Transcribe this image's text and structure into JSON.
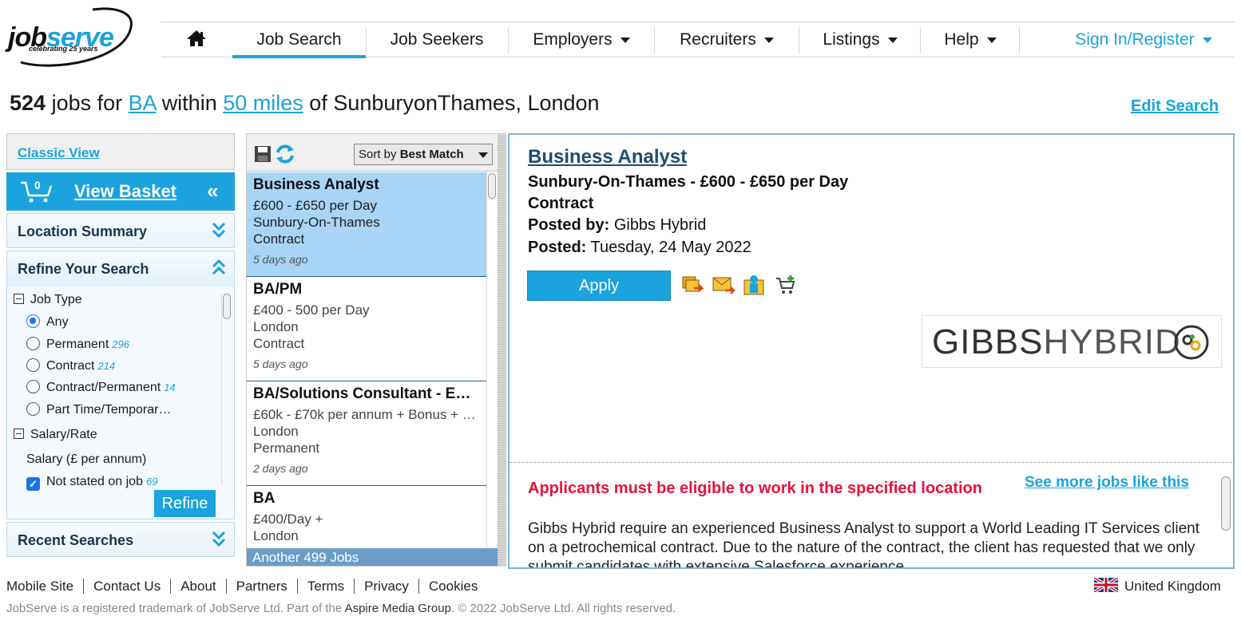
{
  "header": {
    "logo_main": "job",
    "logo_accent": "serve",
    "logo_tagline": "celebrating 25 years",
    "nav": [
      {
        "label": "Job Search"
      },
      {
        "label": "Job Seekers"
      },
      {
        "label": "Employers"
      },
      {
        "label": "Recruiters"
      },
      {
        "label": "Listings"
      },
      {
        "label": "Help"
      }
    ],
    "sign_in": "Sign In/Register"
  },
  "summary": {
    "count": "524",
    "jobs_for": "jobs for",
    "keyword": "BA",
    "within": "within",
    "radius": "50 miles",
    "of_location": "of SunburyonThames, London",
    "edit_search": "Edit Search"
  },
  "sidebar": {
    "classic_view": "Classic View",
    "basket_count": "0",
    "view_basket": "View Basket",
    "location_summary": "Location Summary",
    "refine_your_search": "Refine Your Search",
    "job_type_label": "Job Type",
    "job_types": [
      {
        "label": "Any",
        "count": ""
      },
      {
        "label": "Permanent",
        "count": "296"
      },
      {
        "label": "Contract",
        "count": "214"
      },
      {
        "label": "Contract/Permanent",
        "count": "14"
      },
      {
        "label": "Part Time/Temporar…",
        "count": ""
      }
    ],
    "salary_label": "Salary/Rate",
    "salary_sub": "Salary (£ per annum)",
    "not_stated": "Not stated on job",
    "not_stated_count": "69",
    "refine_button": "Refine",
    "recent_searches": "Recent Searches"
  },
  "results": {
    "sort_prefix": "Sort by",
    "sort_value": "Best Match",
    "jobs": [
      {
        "title": "Business Analyst",
        "rate": "£600 - £650 per Day",
        "location": "Sunbury-On-Thames",
        "type": "Contract",
        "ago": "5 days ago"
      },
      {
        "title": "BA/PM",
        "rate": "£400 - 500 per Day",
        "location": "London",
        "type": "Contract",
        "ago": "5 days ago"
      },
      {
        "title": "BA/Solutions Consultant - E…",
        "rate": "£60k - £70k per annum + Bonus + …",
        "location": "London",
        "type": "Permanent",
        "ago": "2 days ago"
      },
      {
        "title": "BA",
        "rate": "£400/Day +",
        "location": "London",
        "type": "",
        "ago": ""
      }
    ],
    "another": "Another 499 Jobs"
  },
  "detail": {
    "title": "Business Analyst",
    "location_rate": "Sunbury-On-Thames - £600 - £650 per Day",
    "type": "Contract",
    "posted_by_label": "Posted by:",
    "posted_by": "Gibbs Hybrid",
    "posted_label": "Posted:",
    "posted": "Tuesday, 24 May 2022",
    "apply": "Apply",
    "logo_text_bold": "GIBBS",
    "logo_text_light": "HYBRID",
    "eligible": "Applicants must be eligible to work in the specified location",
    "see_more": "See more jobs like this",
    "description": "Gibbs Hybrid require an experienced Business Analyst to support a World Leading IT Services client on a petrochemical contract. Due to the nature of the contract, the client has requested that we only submit candidates with extensive Salesforce experience."
  },
  "footer": {
    "links": [
      "Mobile Site",
      "Contact Us",
      "About",
      "Partners",
      "Terms",
      "Privacy",
      "Cookies"
    ],
    "country": "United Kingdom",
    "copy_pre": "JobServe is a registered trademark of JobServe Ltd. Part of the",
    "copy_amg": "Aspire Media Group",
    "copy_post": ". © 2022 JobServe Ltd. All rights reserved."
  },
  "colors": {
    "brand": "#1aa3dd",
    "selected_row": "#a8d4f5",
    "warning": "#e8113d"
  }
}
